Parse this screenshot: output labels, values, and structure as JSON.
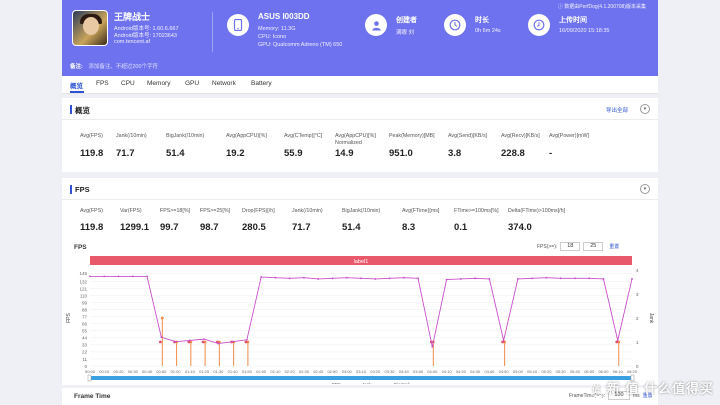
{
  "header": {
    "app_name": "王牌战士",
    "app_version": "Android版本号: 1.60.6.667",
    "android_version": "Android版本号: 17023643",
    "package": "com.tencent.af",
    "device_name": "ASUS I003DD",
    "device_memory": "Memory: 11.3G",
    "device_cpu": "CPU: Icono",
    "device_gpu": "GPU: Qualcomm Adreno (TM) 650",
    "creator_label": "创建者",
    "creator_value": "满眼 刘",
    "duration_label": "时长",
    "duration_value": "0h 6m 24s",
    "upload_label": "上传时间",
    "upload_value": "16/09/2020 15:18:35",
    "version_note": "数据由PerfDog(4.1.200708)版本采集",
    "remark_label": "备注:",
    "remark_hint": "添加备注、不超过200个字符"
  },
  "tabs": [
    "概览",
    "FPS",
    "CPU",
    "Memory",
    "GPU",
    "Network",
    "Battery"
  ],
  "overview": {
    "title": "概览",
    "export": "导出全部",
    "metrics": [
      {
        "label": "Avg(FPS)",
        "value": "119.8"
      },
      {
        "label": "Jank(/10min)",
        "value": "71.7"
      },
      {
        "label": "BigJank(/10min)",
        "value": "51.4"
      },
      {
        "label": "Avg(AppCPU)[%]",
        "value": "19.2"
      },
      {
        "label": "Avg(CTemp)[°C]",
        "value": "55.9"
      },
      {
        "label": "Avg(AppCPU)[%] Normalized",
        "value": "14.9"
      },
      {
        "label": "Peak(Memory)[MB]",
        "value": "951.0"
      },
      {
        "label": "Avg(Send)[KB/s]",
        "value": "3.8"
      },
      {
        "label": "Avg(Recv)[KB/s]",
        "value": "228.8"
      },
      {
        "label": "Avg(Power)[mW]",
        "value": "-"
      }
    ]
  },
  "fps_panel": {
    "title": "FPS",
    "metrics": [
      {
        "label": "Avg(FPS)",
        "value": "119.8"
      },
      {
        "label": "Var(FPS)",
        "value": "1299.1"
      },
      {
        "label": "FPS>=18[%]",
        "value": "99.7"
      },
      {
        "label": "FPS>=25[%]",
        "value": "98.7"
      },
      {
        "label": "Drop(FPS)[/h]",
        "value": "280.5"
      },
      {
        "label": "Jank(/10min)",
        "value": "71.7"
      },
      {
        "label": "BigJank(/10min)",
        "value": "51.4"
      },
      {
        "label": "Avg(FTime)[ms]",
        "value": "8.3"
      },
      {
        "label": "FTime>=100ms[%]",
        "value": "0.1"
      },
      {
        "label": "Delta(FTime)>100ms[/h]",
        "value": "374.0"
      }
    ],
    "chart_title": "FPS",
    "filter_label": "FPS(>=):",
    "filter_a": "18",
    "filter_b": "25",
    "reset": "重置"
  },
  "frametime": {
    "title": "Frame Time",
    "filter_label": "FrameTime(>=):",
    "filter_value": "100",
    "unit": "ms",
    "reset": "重置"
  },
  "watermark": "新 值 什么值得买",
  "colors": {
    "header": "#6f72ee",
    "accent": "#2f55d4",
    "fps_line": "#c94fc9",
    "jank": "#f08a4b",
    "bigjank": "#e0506a",
    "label_band": "#e8596b",
    "scroll": "#3aa0e0"
  },
  "chart_data": {
    "type": "line",
    "title": "FPS",
    "label_band": "label1",
    "x": [
      "00:00",
      "00:10",
      "00:20",
      "00:30",
      "00:40",
      "00:50",
      "01:00",
      "01:10",
      "01:20",
      "01:30",
      "01:40",
      "01:50",
      "02:00",
      "02:10",
      "02:20",
      "02:30",
      "02:40",
      "02:50",
      "03:00",
      "03:10",
      "03:20",
      "03:30",
      "03:40",
      "03:50",
      "04:00",
      "04:10",
      "04:20",
      "04:30",
      "04:40",
      "04:50",
      "05:00",
      "05:10",
      "05:20",
      "05:30",
      "05:40",
      "05:50",
      "06:00",
      "06:10",
      "06:20"
    ],
    "ylim_left": [
      0,
      150
    ],
    "yticks_left": [
      0,
      11,
      22,
      33,
      44,
      55,
      66,
      77,
      88,
      99,
      110,
      121,
      132,
      145
    ],
    "ylim_right": [
      0,
      4
    ],
    "yticks_right": [
      0,
      1,
      2,
      3,
      4
    ],
    "ylabel_left": "FPS",
    "ylabel_right": "Jank",
    "series": [
      {
        "name": "FPS",
        "axis": "left",
        "values": [
          140,
          140,
          140,
          140,
          140,
          45,
          38,
          40,
          42,
          35,
          38,
          41,
          139,
          138,
          137,
          138,
          136,
          137,
          138,
          137,
          136,
          137,
          138,
          137,
          30,
          135,
          136,
          137,
          136,
          40,
          136,
          137,
          138,
          137,
          137,
          137,
          136,
          40,
          136
        ]
      },
      {
        "name": "Jank",
        "axis": "right",
        "values": [
          0,
          0,
          0,
          0,
          0,
          2,
          1,
          1,
          1,
          1,
          1,
          1,
          0,
          0,
          0,
          0,
          0,
          0,
          0,
          0,
          0,
          0,
          0,
          0,
          1,
          0,
          0,
          0,
          0,
          1,
          0,
          0,
          0,
          0,
          0,
          0,
          0,
          1,
          0
        ]
      },
      {
        "name": "BigJank",
        "axis": "right",
        "values": [
          0,
          0,
          0,
          0,
          0,
          1,
          1,
          1,
          1,
          1,
          1,
          1,
          0,
          0,
          0,
          0,
          0,
          0,
          0,
          0,
          0,
          0,
          0,
          0,
          1,
          0,
          0,
          0,
          0,
          1,
          0,
          0,
          0,
          0,
          0,
          0,
          0,
          1,
          0
        ]
      }
    ]
  }
}
